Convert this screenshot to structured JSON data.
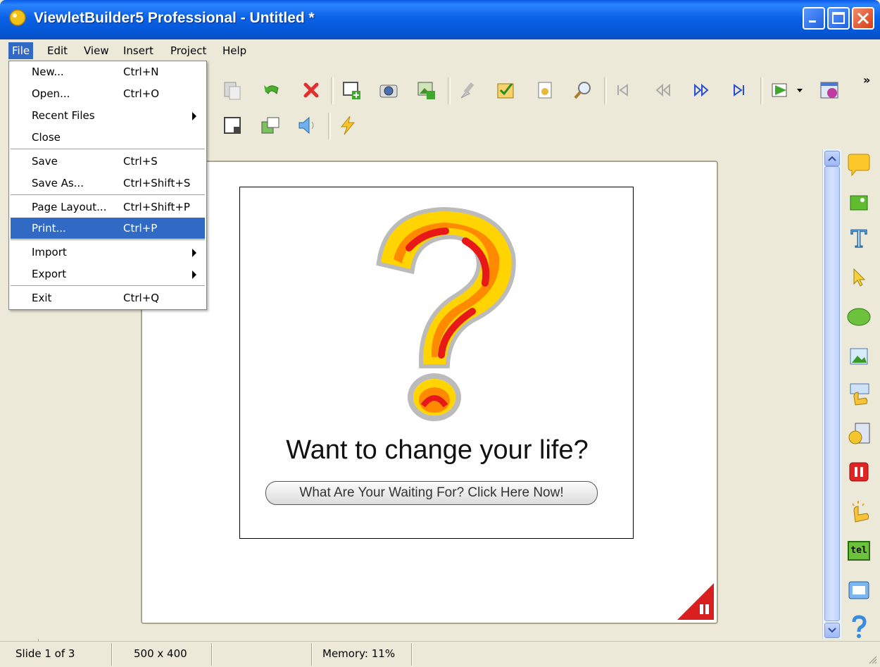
{
  "window": {
    "title": "ViewletBuilder5 Professional - Untitled *"
  },
  "menubar": {
    "items": [
      "File",
      "Edit",
      "View",
      "Insert",
      "Project",
      "Help"
    ]
  },
  "file_menu": {
    "items": [
      {
        "label": "New...",
        "shortcut": "Ctrl+N"
      },
      {
        "label": "Open...",
        "shortcut": "Ctrl+O"
      },
      {
        "label": "Recent Files",
        "shortcut": ""
      },
      {
        "label": "Close",
        "shortcut": ""
      },
      {
        "label": "Save",
        "shortcut": "Ctrl+S"
      },
      {
        "label": "Save As...",
        "shortcut": "Ctrl+Shift+S"
      },
      {
        "label": "Page Layout...",
        "shortcut": "Ctrl+Shift+P"
      },
      {
        "label": "Print...",
        "shortcut": "Ctrl+P"
      },
      {
        "label": "Import",
        "shortcut": ""
      },
      {
        "label": "Export",
        "shortcut": ""
      },
      {
        "label": "Exit",
        "shortcut": "Ctrl+Q"
      }
    ],
    "highlighted": "Print..."
  },
  "toolbar": {
    "overflow_glyph": "»"
  },
  "slide": {
    "headline": "Want to change your life?",
    "button_label": "What Are Your Waiting For? Click Here Now!"
  },
  "right_toolbar": {
    "text_tool_label": "T",
    "text_box_label": "tel"
  },
  "status": {
    "slide_info": "Slide 1 of 3",
    "dimensions": "500 x 400",
    "memory": "Memory: 11%"
  },
  "colors": {
    "title_blue": "#0a5be8",
    "menu_highlight": "#316ac5",
    "chrome": "#ece9d8"
  }
}
